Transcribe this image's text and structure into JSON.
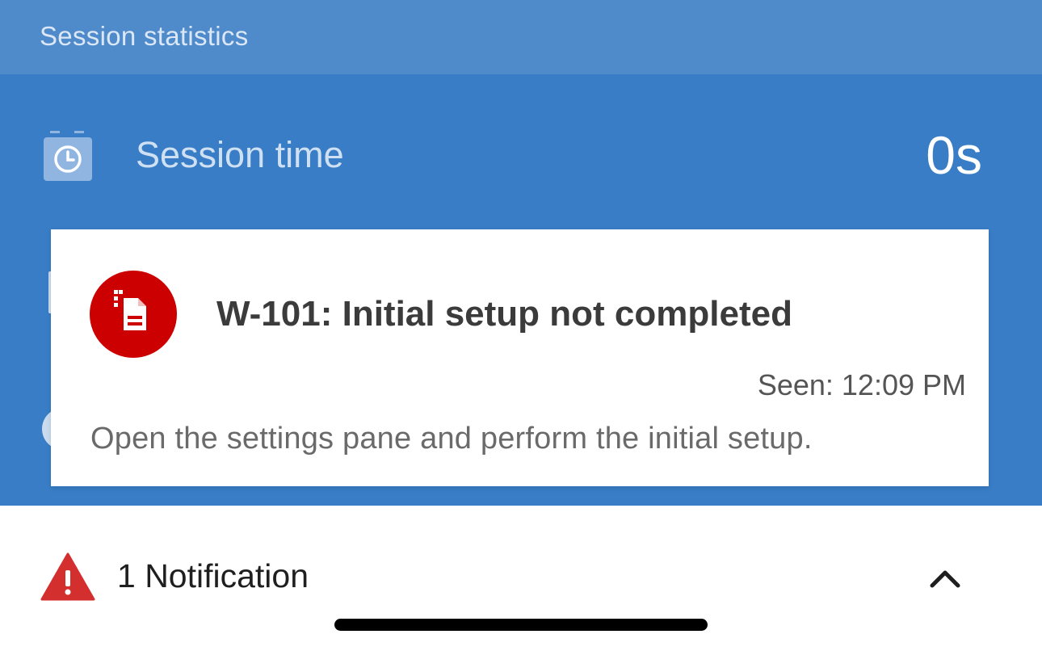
{
  "header": {
    "title": "Session statistics"
  },
  "stats": {
    "session_time": {
      "label": "Session time",
      "value": "0s",
      "icon": "stopwatch-icon"
    }
  },
  "notification_card": {
    "code_title": "W-101: Initial setup not completed",
    "seen": "Seen: 12:09 PM",
    "message": "Open the settings pane and perform the initial setup.",
    "icon": "document-warning-icon",
    "accent_color": "#cc0000"
  },
  "notification_bar": {
    "label": "1 Notification",
    "icon": "warning-triangle-icon",
    "toggle_icon": "chevron-up-icon",
    "warning_color": "#d32f2f"
  },
  "colors": {
    "header_bg": "#4f8acb",
    "stats_bg": "#387dc6"
  }
}
